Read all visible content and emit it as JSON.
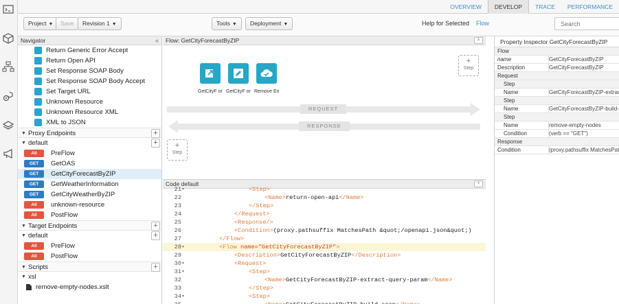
{
  "rail": {
    "icons": [
      "terminal-icon",
      "cube-icon",
      "network-icon",
      "gear-cube-icon",
      "layers-icon",
      "megaphone-icon"
    ]
  },
  "tabs": [
    {
      "label": "OVERVIEW",
      "active": false
    },
    {
      "label": "DEVELOP",
      "active": true
    },
    {
      "label": "TRACE",
      "active": false
    },
    {
      "label": "PERFORMANCE",
      "active": false
    }
  ],
  "toolbar": {
    "project_label": "Project",
    "save_label": "Save",
    "revision_label": "Revision 1",
    "tools_label": "Tools",
    "deployment_label": "Deployment",
    "help_label": "Help for Selected",
    "help_link": "Flow",
    "search_placeholder": "Search"
  },
  "navigator": {
    "title": "Navigator",
    "collapse": "«",
    "policies": [
      {
        "label": "Return Generic Error Accept",
        "icon": "return-icon"
      },
      {
        "label": "Return Open API",
        "icon": "return-icon"
      },
      {
        "label": "Set Response SOAP Body",
        "icon": "pencil-icon"
      },
      {
        "label": "Set Response SOAP Body Accept",
        "icon": "pencil-icon"
      },
      {
        "label": "Set Target URL",
        "icon": "pencil-icon"
      },
      {
        "label": "Unknown Resource",
        "icon": "return-icon"
      },
      {
        "label": "Unknown Resource XML",
        "icon": "return-icon"
      },
      {
        "label": "XML to JSON",
        "icon": "convert-icon"
      }
    ],
    "proxy_endpoints_label": "Proxy Endpoints",
    "proxy_default_label": "default",
    "proxy_flows": [
      {
        "method": "All",
        "label": "PreFlow",
        "selected": false
      },
      {
        "method": "GET",
        "label": "GetOAS",
        "selected": false
      },
      {
        "method": "GET",
        "label": "GetCityForecastByZIP",
        "selected": true
      },
      {
        "method": "GET",
        "label": "GetWeatherInformation",
        "selected": false
      },
      {
        "method": "GET",
        "label": "GetCityWeatherByZIP",
        "selected": false
      },
      {
        "method": "All",
        "label": "unknown-resource",
        "selected": false
      },
      {
        "method": "All",
        "label": "PostFlow",
        "selected": false
      }
    ],
    "target_endpoints_label": "Target Endpoints",
    "target_default_label": "default",
    "target_flows": [
      {
        "method": "All",
        "label": "PreFlow"
      },
      {
        "method": "All",
        "label": "PostFlow"
      }
    ],
    "scripts_label": "Scripts",
    "xsl_label": "xsl",
    "script_file": "remove-empty-nodes.xslt"
  },
  "flow": {
    "title": "Flow: GetCityForecastByZIP",
    "collapse": "˄",
    "steps": [
      {
        "icon": "extract-icon",
        "label": "GetCityF orecast..."
      },
      {
        "icon": "pencil-icon",
        "label": "GetCityF orecast..."
      },
      {
        "icon": "cloud-check-icon",
        "label": "Remove Empty ..."
      }
    ],
    "add_step": {
      "plus": "+",
      "label": "Step"
    },
    "request_label": "REQUEST",
    "response_label": "RESPONSE"
  },
  "code": {
    "title": "Code  default",
    "collapse": "˅",
    "lines": [
      {
        "n": "21",
        "fold": true,
        "text": "<Step>",
        "hl": false
      },
      {
        "n": "22",
        "fold": false,
        "text": "<Name>return-open-api</Name>",
        "hl": false
      },
      {
        "n": "23",
        "fold": false,
        "text": "</Step>",
        "hl": false
      },
      {
        "n": "24",
        "fold": false,
        "text": "</Request>",
        "hl": false
      },
      {
        "n": "25",
        "fold": false,
        "text": "<Response/>",
        "hl": false
      },
      {
        "n": "26",
        "fold": false,
        "text": "<Condition>(proxy.pathsuffix MatchesPath &quot;/openapi.json&quot;)",
        "hl": false
      },
      {
        "n": "27",
        "fold": false,
        "text": "</Flow>",
        "hl": false
      },
      {
        "n": "28",
        "fold": true,
        "text": "<Flow name=\"GetCityForecastByZIP\">",
        "hl": true
      },
      {
        "n": "29",
        "fold": false,
        "text": "<Description>GetCityForecastByZIP</Description>",
        "hl": false
      },
      {
        "n": "30",
        "fold": true,
        "text": "<Request>",
        "hl": false
      },
      {
        "n": "31",
        "fold": true,
        "text": "<Step>",
        "hl": false
      },
      {
        "n": "32",
        "fold": false,
        "text": "<Name>GetCityForecastByZIP-extract-query-param</Name>",
        "hl": false
      },
      {
        "n": "33",
        "fold": false,
        "text": "</Step>",
        "hl": false
      },
      {
        "n": "34",
        "fold": true,
        "text": "<Step>",
        "hl": false
      },
      {
        "n": "35",
        "fold": false,
        "text": "<Name>GetCityForecastByZIP-build-soap</Name>",
        "hl": false
      }
    ]
  },
  "inspector": {
    "title": "Property Inspector  GetCityForecastByZIP",
    "rows": [
      {
        "key": "Flow",
        "value": "",
        "section": true
      },
      {
        "key": "name",
        "value": "GetCityForecastByZIP",
        "italic": true
      },
      {
        "key": "Description",
        "value": "GetCityForecastByZIP"
      },
      {
        "key": "Request",
        "value": "",
        "section": true
      },
      {
        "key": "Step",
        "value": "",
        "section": true,
        "indent": true
      },
      {
        "key": "Name",
        "value": "GetCityForecastByZIP-extract-query-param",
        "indent": true
      },
      {
        "key": "Step",
        "value": "",
        "section": true,
        "indent": true
      },
      {
        "key": "Name",
        "value": "GetCityForecastByZIP-build-soap",
        "indent": true
      },
      {
        "key": "Step",
        "value": "",
        "section": true,
        "indent": true
      },
      {
        "key": "Name",
        "value": "remove-empty-nodes",
        "indent": true
      },
      {
        "key": "Condition",
        "value": "(verb == \"GET\")",
        "indent": true
      },
      {
        "key": "Response",
        "value": "",
        "section": true
      },
      {
        "key": "Condition",
        "value": "(proxy.pathsuffix MatchesPath \"/cityforecastbyzip\") and (request.verb = \"GET\")"
      }
    ]
  },
  "colors": {
    "accent": "#3a8fc8",
    "step_tile": "#27a6c8",
    "badge_all": "#e0563f",
    "badge_get": "#2e7bc4",
    "selected_row": "#dfeefa"
  }
}
